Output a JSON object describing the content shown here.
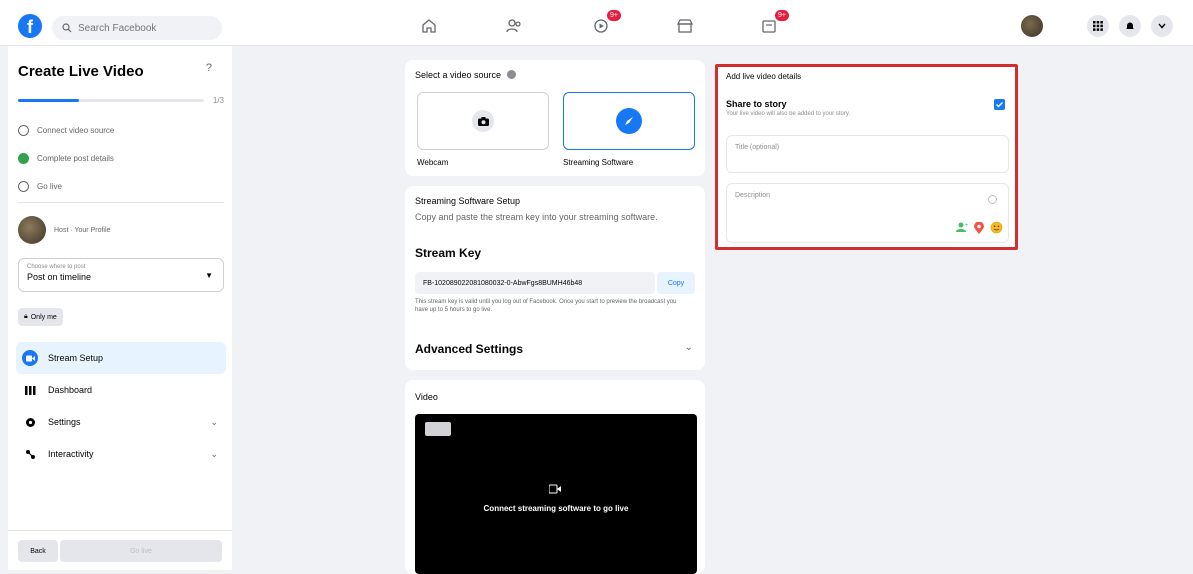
{
  "topbar": {
    "logo": "f",
    "search_placeholder": "Search Facebook",
    "badge_video": "9+",
    "badge_pages": "9+"
  },
  "sidebar": {
    "title": "Create Live Video",
    "help": "?",
    "progress_label": "1/3",
    "progress": 0.33,
    "steps": [
      {
        "label": "Connect video source",
        "done": false
      },
      {
        "label": "Complete post details",
        "done": true
      },
      {
        "label": "Go live",
        "done": false
      }
    ],
    "profile_name": "Host · Your Profile",
    "post_select_label": "Choose where to post",
    "post_select_value": "Post on timeline",
    "audience": "Only me",
    "menu": [
      {
        "label": "Stream Setup",
        "active": true
      },
      {
        "label": "Dashboard"
      },
      {
        "label": "Settings"
      },
      {
        "label": "Interactivity"
      }
    ],
    "back_label": "Back",
    "golive_label": "Go live"
  },
  "source": {
    "title": "Select a video source",
    "webcam_label": "Webcam",
    "streaming_label": "Streaming Software"
  },
  "setup": {
    "title": "Streaming Software Setup",
    "desc": "Copy and paste the stream key into your streaming software.",
    "stream_key_title": "Stream Key",
    "stream_key": "FB-102089022081080032-0-AbwFgs8BUMH46b48",
    "copy_label": "Copy",
    "note": "This stream key is valid until you log out of Facebook. Once you start to preview the broadcast you have up to 5 hours to go live.",
    "advanced_title": "Advanced Settings"
  },
  "video": {
    "title": "Video",
    "message": "Connect streaming software to go live"
  },
  "details": {
    "title": "Add live video details",
    "share_title": "Share to story",
    "share_sub": "Your live video will also be added to your story.",
    "title_placeholder": "Title (optional)",
    "description_placeholder": "Description"
  },
  "colors": {
    "accent": "#1877f2",
    "highlight_border": "#d12f2f",
    "done_green": "#31a24c"
  }
}
